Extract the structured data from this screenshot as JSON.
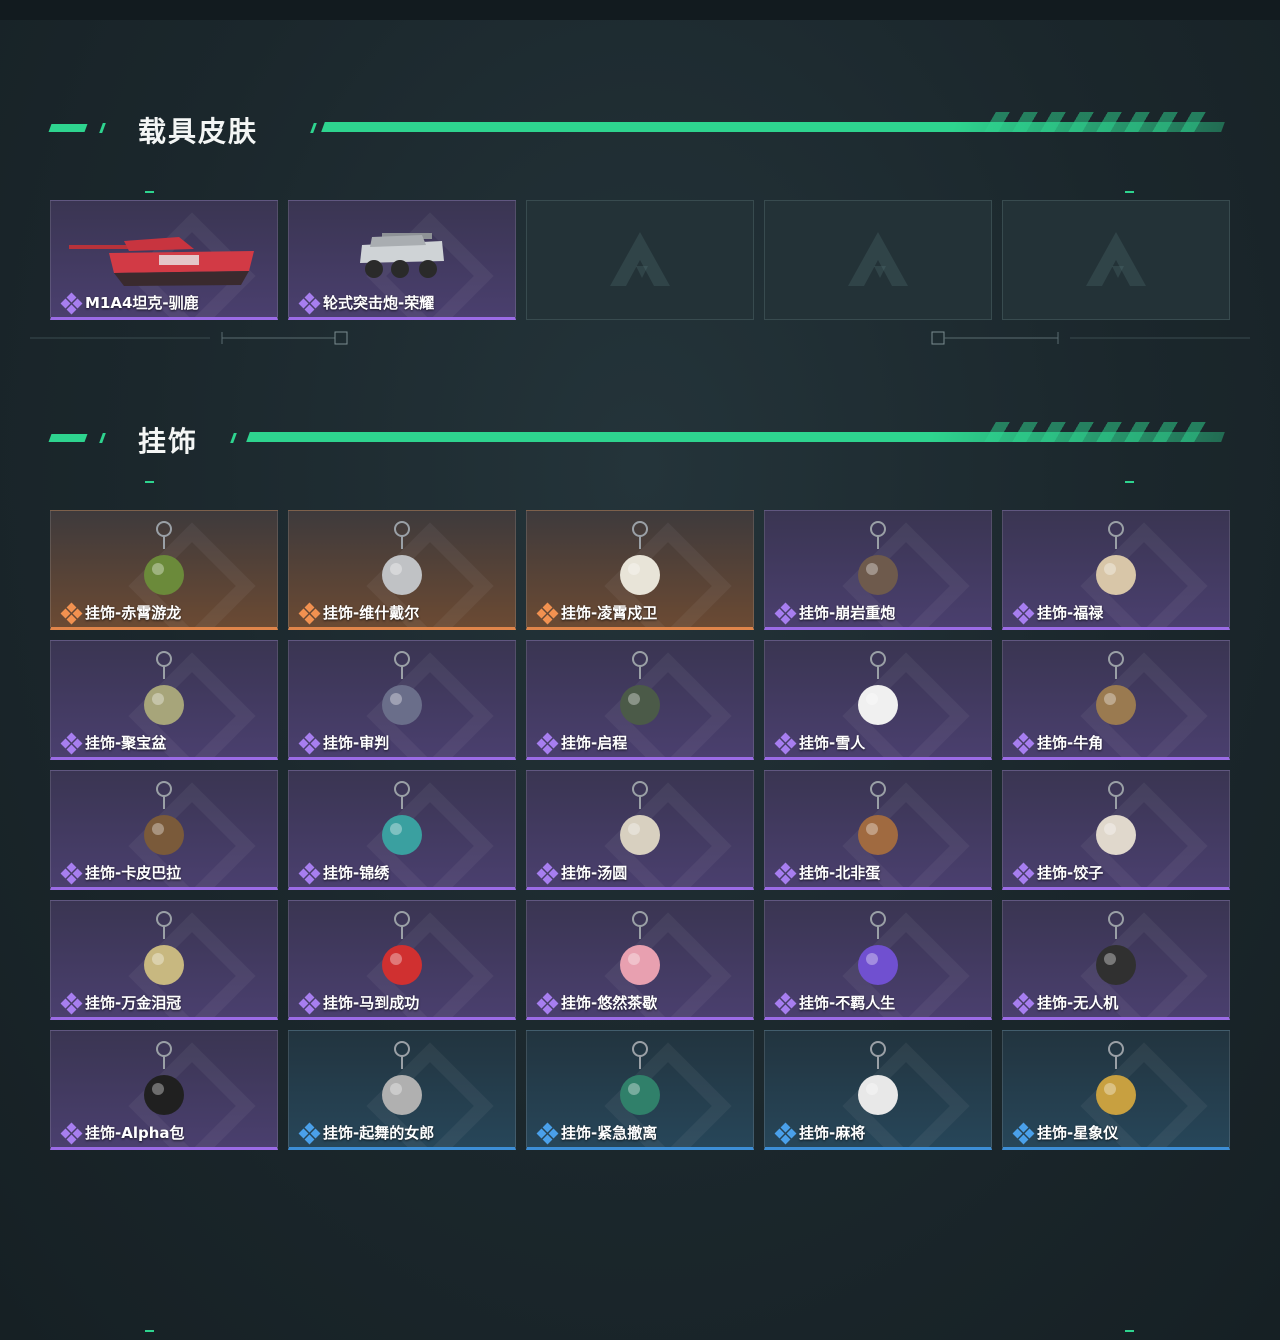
{
  "sections": {
    "vehicle_skins": {
      "title": "载具皮肤",
      "items": [
        {
          "label": "M1A4坦克-驯鹿",
          "rarity": "purple",
          "art": "red-tank-art"
        },
        {
          "label": "轮式突击炮-荣耀",
          "rarity": "purple",
          "art": "wheeled-assault-gun-art"
        },
        {
          "label": "",
          "rarity": "empty",
          "art": "placeholder-logo"
        },
        {
          "label": "",
          "rarity": "empty",
          "art": "placeholder-logo"
        },
        {
          "label": "",
          "rarity": "empty",
          "art": "placeholder-logo"
        }
      ]
    },
    "charms": {
      "title": "挂饰",
      "items": [
        {
          "label": "挂饰-赤霄游龙",
          "rarity": "orange"
        },
        {
          "label": "挂饰-维什戴尔",
          "rarity": "orange"
        },
        {
          "label": "挂饰-凌霄戍卫",
          "rarity": "orange"
        },
        {
          "label": "挂饰-崩岩重炮",
          "rarity": "purple"
        },
        {
          "label": "挂饰-福禄",
          "rarity": "purple"
        },
        {
          "label": "挂饰-聚宝盆",
          "rarity": "purple"
        },
        {
          "label": "挂饰-审判",
          "rarity": "purple"
        },
        {
          "label": "挂饰-启程",
          "rarity": "purple"
        },
        {
          "label": "挂饰-雪人",
          "rarity": "purple"
        },
        {
          "label": "挂饰-牛角",
          "rarity": "purple"
        },
        {
          "label": "挂饰-卡皮巴拉",
          "rarity": "purple"
        },
        {
          "label": "挂饰-锦绣",
          "rarity": "purple"
        },
        {
          "label": "挂饰-汤圆",
          "rarity": "purple"
        },
        {
          "label": "挂饰-北非蛋",
          "rarity": "purple"
        },
        {
          "label": "挂饰-饺子",
          "rarity": "purple"
        },
        {
          "label": "挂饰-万金泪冠",
          "rarity": "purple"
        },
        {
          "label": "挂饰-马到成功",
          "rarity": "purple"
        },
        {
          "label": "挂饰-悠然茶歇",
          "rarity": "purple"
        },
        {
          "label": "挂饰-不羁人生",
          "rarity": "purple"
        },
        {
          "label": "挂饰-无人机",
          "rarity": "purple"
        },
        {
          "label": "挂饰-Alpha包",
          "rarity": "purple"
        },
        {
          "label": "挂饰-起舞的女郎",
          "rarity": "blue"
        },
        {
          "label": "挂饰-紧急撤离",
          "rarity": "blue"
        },
        {
          "label": "挂饰-麻将",
          "rarity": "blue"
        },
        {
          "label": "挂饰-星象仪",
          "rarity": "blue"
        }
      ]
    }
  },
  "colors": {
    "accent": "#2ed48f",
    "rarity_purple": "#9b6be6",
    "rarity_orange": "#e0854a",
    "rarity_blue": "#3d8ed6"
  }
}
